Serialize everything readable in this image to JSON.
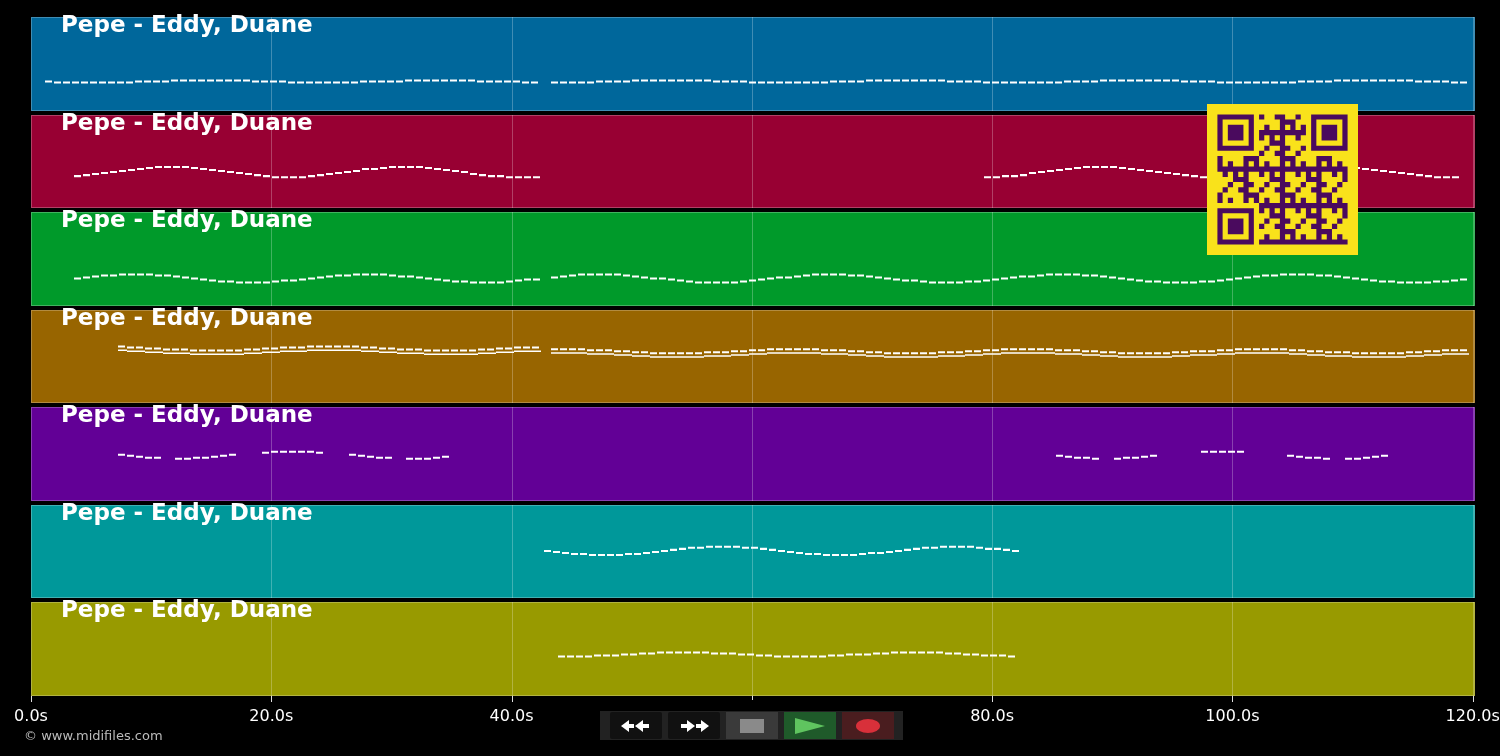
{
  "tracks": [
    {
      "title": "Pepe - Eddy, Duane",
      "color": "#00679b"
    },
    {
      "title": "Pepe - Eddy, Duane",
      "color": "#980033"
    },
    {
      "title": "Pepe - Eddy, Duane",
      "color": "#009a2a"
    },
    {
      "title": "Pepe - Eddy, Duane",
      "color": "#986500"
    },
    {
      "title": "Pepe - Eddy, Duane",
      "color": "#620096"
    },
    {
      "title": "Pepe - Eddy, Duane",
      "color": "#00989a"
    },
    {
      "title": "Pepe - Eddy, Duane",
      "color": "#989a00"
    }
  ],
  "time_axis": {
    "ticks": [
      {
        "label": "0.0s",
        "covered": false
      },
      {
        "label": "20.0s",
        "covered": false
      },
      {
        "label": "40.0s",
        "covered": false
      },
      {
        "covered": true
      },
      {
        "label": "80.0s",
        "covered": false
      },
      {
        "label": "100.0s",
        "covered": false
      },
      {
        "label": "120.0s",
        "covered": false
      }
    ]
  },
  "transport": [
    {
      "kind": "rewind"
    },
    {
      "kind": "forward"
    },
    {
      "kind": "stop"
    },
    {
      "kind": "play"
    },
    {
      "kind": "record"
    }
  ],
  "copyright": "© www.midifiles.com"
}
